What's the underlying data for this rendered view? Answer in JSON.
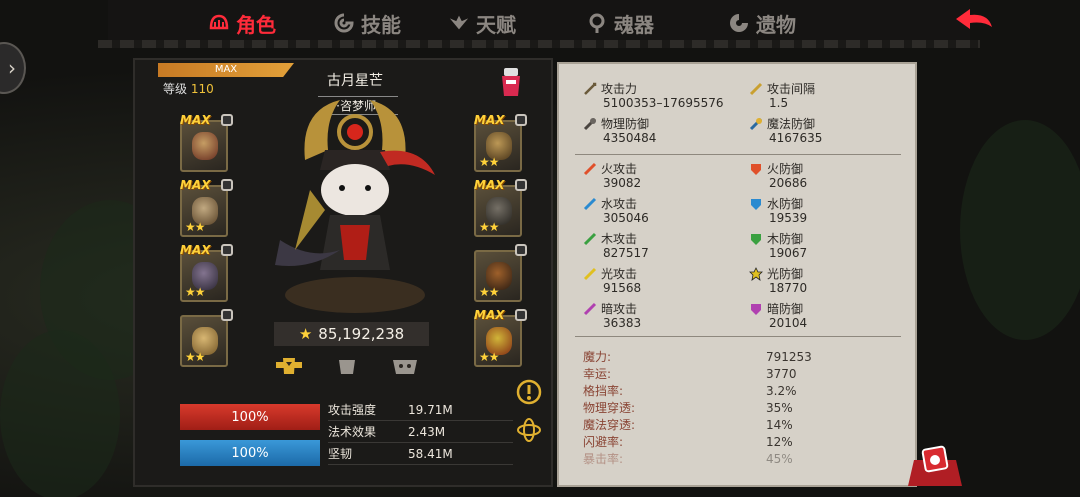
{
  "tabs": [
    {
      "label": "角色",
      "icon": "helmet-icon",
      "active": true
    },
    {
      "label": "技能",
      "icon": "swirl-icon",
      "active": false
    },
    {
      "label": "天赋",
      "icon": "wings-icon",
      "active": false
    },
    {
      "label": "魂器",
      "icon": "soul-icon",
      "active": false
    },
    {
      "label": "遗物",
      "icon": "relic-icon",
      "active": false
    }
  ],
  "colors": {
    "accent": "#ff2b3a",
    "hp": "#d83a2c",
    "mp": "#3a98d8",
    "star": "#ffd23a"
  },
  "character": {
    "max_label": "MAX",
    "level_label": "等级",
    "level_value": "110",
    "name": "古月星芒",
    "title": "·咨梦师·",
    "power": "85,192,238"
  },
  "equipment_left": [
    {
      "max": "MAX",
      "stars": "",
      "icon": "mask-icon"
    },
    {
      "max": "MAX",
      "stars": "★★",
      "icon": "boots-icon"
    },
    {
      "max": "MAX",
      "stars": "★★",
      "icon": "claw-icon"
    },
    {
      "max": "",
      "stars": "★★",
      "icon": "horn-icon"
    }
  ],
  "equipment_right": [
    {
      "max": "MAX",
      "stars": "★★",
      "icon": "helmet-icon"
    },
    {
      "max": "MAX",
      "stars": "★★",
      "icon": "armor-icon"
    },
    {
      "max": "",
      "stars": "★★",
      "icon": "gauntlet-icon"
    },
    {
      "max": "MAX",
      "stars": "★★",
      "icon": "gem-icon"
    }
  ],
  "bars": {
    "hp": "100%",
    "mp": "100%"
  },
  "summary_stats": [
    {
      "label": "攻击强度",
      "value": "19.71M"
    },
    {
      "label": "法术效果",
      "value": "2.43M"
    },
    {
      "label": "坚韧",
      "value": "58.41M"
    }
  ],
  "stats": {
    "attack": {
      "label": "攻击力",
      "value": "5100353–17695576"
    },
    "attack_interval": {
      "label": "攻击间隔",
      "value": "1.5"
    },
    "phys_def": {
      "label": "物理防御",
      "value": "4350484"
    },
    "magic_def": {
      "label": "魔法防御",
      "value": "4167635"
    },
    "fire_atk": {
      "label": "火攻击",
      "value": "39082"
    },
    "fire_def": {
      "label": "火防御",
      "value": "20686"
    },
    "water_atk": {
      "label": "水攻击",
      "value": "305046"
    },
    "water_def": {
      "label": "水防御",
      "value": "19539"
    },
    "wood_atk": {
      "label": "木攻击",
      "value": "827517"
    },
    "wood_def": {
      "label": "木防御",
      "value": "19067"
    },
    "light_atk": {
      "label": "光攻击",
      "value": "91568"
    },
    "light_def": {
      "label": "光防御",
      "value": "18770"
    },
    "dark_atk": {
      "label": "暗攻击",
      "value": "36383"
    },
    "dark_def": {
      "label": "暗防御",
      "value": "20104"
    }
  },
  "advanced": [
    {
      "label": "魔力:",
      "value": "791253"
    },
    {
      "label": "幸运:",
      "value": "3770"
    },
    {
      "label": "格挡率:",
      "value": "3.2%"
    },
    {
      "label": "物理穿透:",
      "value": "35%"
    },
    {
      "label": "魔法穿透:",
      "value": "14%"
    },
    {
      "label": "闪避率:",
      "value": "12%"
    },
    {
      "label": "暴击率:",
      "value": "45%"
    }
  ]
}
